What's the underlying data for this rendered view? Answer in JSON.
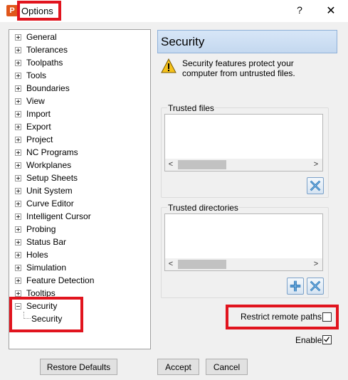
{
  "window": {
    "title": "Options",
    "app_icon_letter": "P",
    "help_label": "?",
    "close_label": "✕"
  },
  "tree": {
    "items": [
      {
        "label": "General",
        "expander": "plus"
      },
      {
        "label": "Tolerances",
        "expander": "plus"
      },
      {
        "label": "Toolpaths",
        "expander": "plus"
      },
      {
        "label": "Tools",
        "expander": "plus"
      },
      {
        "label": "Boundaries",
        "expander": "plus"
      },
      {
        "label": "View",
        "expander": "plus"
      },
      {
        "label": "Import",
        "expander": "plus"
      },
      {
        "label": "Export",
        "expander": "plus"
      },
      {
        "label": "Project",
        "expander": "plus"
      },
      {
        "label": "NC Programs",
        "expander": "plus"
      },
      {
        "label": "Workplanes",
        "expander": "plus"
      },
      {
        "label": "Setup Sheets",
        "expander": "plus"
      },
      {
        "label": "Unit System",
        "expander": "plus"
      },
      {
        "label": "Curve Editor",
        "expander": "plus"
      },
      {
        "label": "Intelligent Cursor",
        "expander": "plus"
      },
      {
        "label": "Probing",
        "expander": "plus"
      },
      {
        "label": "Status Bar",
        "expander": "plus"
      },
      {
        "label": "Holes",
        "expander": "plus"
      },
      {
        "label": "Simulation",
        "expander": "plus"
      },
      {
        "label": "Feature Detection",
        "expander": "plus"
      },
      {
        "label": "Tooltips",
        "expander": "plus"
      },
      {
        "label": "Security",
        "expander": "minus"
      }
    ],
    "child": {
      "label": "Security"
    }
  },
  "panel": {
    "title": "Security",
    "warning_icon": "warning-triangle-icon",
    "warning_text": "Security features protect your computer from untrusted files.",
    "trusted_files_label": "Trusted files",
    "trusted_dirs_label": "Trusted directories",
    "restrict_label": "Restrict remote paths",
    "restrict_checked": false,
    "enable_label": "Enable",
    "enable_checked": true
  },
  "buttons": {
    "restore_defaults": "Restore Defaults",
    "accept": "Accept",
    "cancel": "Cancel"
  },
  "colors": {
    "highlight": "#e1141e",
    "header_bg": "#c4d8ef",
    "tool_icon": "#1f6fb2"
  }
}
